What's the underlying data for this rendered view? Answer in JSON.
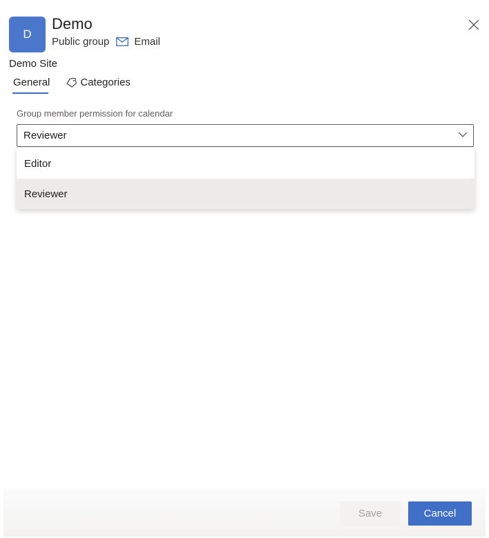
{
  "group": {
    "avatar_initial": "D",
    "name": "Demo",
    "privacy": "Public group",
    "email_label": "Email",
    "site_label": "Demo Site"
  },
  "tabs": [
    {
      "label": "General",
      "active": true
    },
    {
      "label": "Categories",
      "icon": "tag-icon",
      "active": false
    }
  ],
  "permission": {
    "label": "Group member permission for calendar",
    "selected": "Reviewer",
    "options": [
      "Editor",
      "Reviewer"
    ]
  },
  "footer": {
    "save_label": "Save",
    "cancel_label": "Cancel"
  },
  "colors": {
    "accent": "#3f6fc6",
    "avatar": "#4a76cc"
  }
}
